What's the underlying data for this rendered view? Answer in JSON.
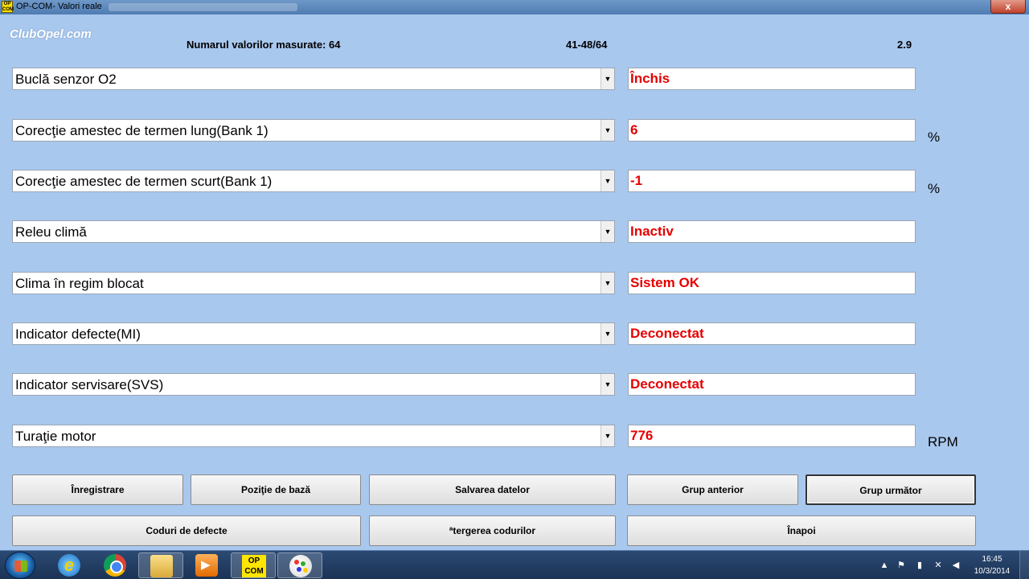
{
  "window": {
    "title": "OP-COM- Valori reale",
    "app_icon_text": [
      "OP",
      "COM"
    ],
    "close_label": "x"
  },
  "header": {
    "logo": "ClubOpel.com",
    "count_label": "Numarul valorilor masurate: 64",
    "range_label": "41-48/64",
    "version_label": "2.9"
  },
  "rows": [
    {
      "param": "Buclă senzor O2",
      "value": "Închis",
      "unit": ""
    },
    {
      "param": "Corecţie amestec de termen lung(Bank 1)",
      "value": "6",
      "unit": "%"
    },
    {
      "param": "Corecţie amestec de termen scurt(Bank 1)",
      "value": "-1",
      "unit": "%"
    },
    {
      "param": "Releu climă",
      "value": "Inactiv",
      "unit": ""
    },
    {
      "param": "Clima în regim blocat",
      "value": "Sistem OK",
      "unit": ""
    },
    {
      "param": "Indicator defecte(MI)",
      "value": "Deconectat",
      "unit": ""
    },
    {
      "param": "Indicator servisare(SVS)",
      "value": "Deconectat",
      "unit": ""
    },
    {
      "param": "Turaţie motor",
      "value": "776",
      "unit": "RPM"
    }
  ],
  "buttons": {
    "record": "Înregistrare",
    "base_position": "Poziţie de bază",
    "save_data": "Salvarea datelor",
    "prev_group": "Grup anterior",
    "next_group": "Grup următor",
    "fault_codes": "Coduri de defecte",
    "clear_codes": "ªtergerea codurilor",
    "back": "Înapoi"
  },
  "taskbar": {
    "opcom_label": [
      "OP",
      "COM"
    ],
    "clock_time": "16:45",
    "clock_date": "10/3/2014",
    "icons": [
      "start-icon",
      "ie-icon",
      "chrome-icon",
      "explorer-icon",
      "media-player-icon",
      "opcom-icon",
      "paint-icon"
    ]
  },
  "colors": {
    "window_bg": "#a9c8ee",
    "value_text": "#e60000",
    "taskbar": "#1b3355"
  }
}
